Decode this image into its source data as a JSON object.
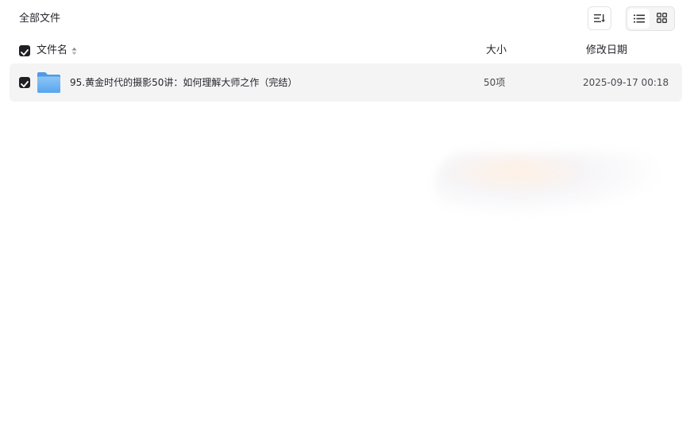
{
  "page": {
    "title": "全部文件"
  },
  "toolbar": {
    "sort_icon": "sort-icon",
    "view_modes": [
      {
        "icon": "list-view-icon",
        "active": true
      },
      {
        "icon": "grid-view-icon",
        "active": false
      }
    ]
  },
  "table": {
    "columns": {
      "name": "文件名",
      "size": "大小",
      "date": "修改日期"
    },
    "select_all_checked": true,
    "rows": [
      {
        "checked": true,
        "icon": "folder-icon",
        "name": "95.黄金时代的摄影50讲：如何理解大师之作（完结）",
        "size": "50项",
        "date": "2025-09-17 00:18"
      }
    ]
  },
  "colors": {
    "row_selected_bg": "#f4f4f5",
    "checkbox": "#1f2023",
    "folder": "#5aa6ee"
  }
}
